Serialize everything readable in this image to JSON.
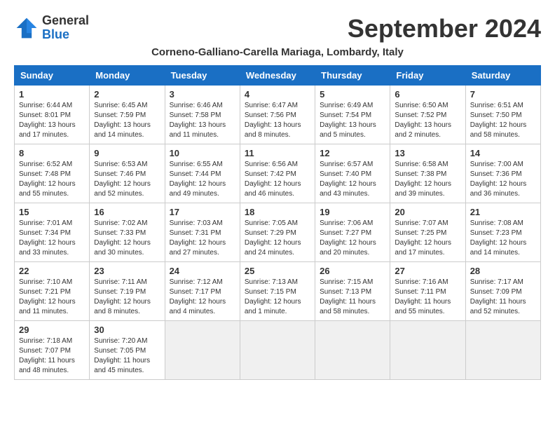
{
  "header": {
    "title": "September 2024",
    "subtitle": "Corneno-Galliano-Carella Mariaga, Lombardy, Italy",
    "logo": {
      "line1": "General",
      "line2": "Blue"
    }
  },
  "weekdays": [
    "Sunday",
    "Monday",
    "Tuesday",
    "Wednesday",
    "Thursday",
    "Friday",
    "Saturday"
  ],
  "weeks": [
    [
      {
        "day": "1",
        "info": "Sunrise: 6:44 AM\nSunset: 8:01 PM\nDaylight: 13 hours and 17 minutes."
      },
      {
        "day": "2",
        "info": "Sunrise: 6:45 AM\nSunset: 7:59 PM\nDaylight: 13 hours and 14 minutes."
      },
      {
        "day": "3",
        "info": "Sunrise: 6:46 AM\nSunset: 7:58 PM\nDaylight: 13 hours and 11 minutes."
      },
      {
        "day": "4",
        "info": "Sunrise: 6:47 AM\nSunset: 7:56 PM\nDaylight: 13 hours and 8 minutes."
      },
      {
        "day": "5",
        "info": "Sunrise: 6:49 AM\nSunset: 7:54 PM\nDaylight: 13 hours and 5 minutes."
      },
      {
        "day": "6",
        "info": "Sunrise: 6:50 AM\nSunset: 7:52 PM\nDaylight: 13 hours and 2 minutes."
      },
      {
        "day": "7",
        "info": "Sunrise: 6:51 AM\nSunset: 7:50 PM\nDaylight: 12 hours and 58 minutes."
      }
    ],
    [
      {
        "day": "8",
        "info": "Sunrise: 6:52 AM\nSunset: 7:48 PM\nDaylight: 12 hours and 55 minutes."
      },
      {
        "day": "9",
        "info": "Sunrise: 6:53 AM\nSunset: 7:46 PM\nDaylight: 12 hours and 52 minutes."
      },
      {
        "day": "10",
        "info": "Sunrise: 6:55 AM\nSunset: 7:44 PM\nDaylight: 12 hours and 49 minutes."
      },
      {
        "day": "11",
        "info": "Sunrise: 6:56 AM\nSunset: 7:42 PM\nDaylight: 12 hours and 46 minutes."
      },
      {
        "day": "12",
        "info": "Sunrise: 6:57 AM\nSunset: 7:40 PM\nDaylight: 12 hours and 43 minutes."
      },
      {
        "day": "13",
        "info": "Sunrise: 6:58 AM\nSunset: 7:38 PM\nDaylight: 12 hours and 39 minutes."
      },
      {
        "day": "14",
        "info": "Sunrise: 7:00 AM\nSunset: 7:36 PM\nDaylight: 12 hours and 36 minutes."
      }
    ],
    [
      {
        "day": "15",
        "info": "Sunrise: 7:01 AM\nSunset: 7:34 PM\nDaylight: 12 hours and 33 minutes."
      },
      {
        "day": "16",
        "info": "Sunrise: 7:02 AM\nSunset: 7:33 PM\nDaylight: 12 hours and 30 minutes."
      },
      {
        "day": "17",
        "info": "Sunrise: 7:03 AM\nSunset: 7:31 PM\nDaylight: 12 hours and 27 minutes."
      },
      {
        "day": "18",
        "info": "Sunrise: 7:05 AM\nSunset: 7:29 PM\nDaylight: 12 hours and 24 minutes."
      },
      {
        "day": "19",
        "info": "Sunrise: 7:06 AM\nSunset: 7:27 PM\nDaylight: 12 hours and 20 minutes."
      },
      {
        "day": "20",
        "info": "Sunrise: 7:07 AM\nSunset: 7:25 PM\nDaylight: 12 hours and 17 minutes."
      },
      {
        "day": "21",
        "info": "Sunrise: 7:08 AM\nSunset: 7:23 PM\nDaylight: 12 hours and 14 minutes."
      }
    ],
    [
      {
        "day": "22",
        "info": "Sunrise: 7:10 AM\nSunset: 7:21 PM\nDaylight: 12 hours and 11 minutes."
      },
      {
        "day": "23",
        "info": "Sunrise: 7:11 AM\nSunset: 7:19 PM\nDaylight: 12 hours and 8 minutes."
      },
      {
        "day": "24",
        "info": "Sunrise: 7:12 AM\nSunset: 7:17 PM\nDaylight: 12 hours and 4 minutes."
      },
      {
        "day": "25",
        "info": "Sunrise: 7:13 AM\nSunset: 7:15 PM\nDaylight: 12 hours and 1 minute."
      },
      {
        "day": "26",
        "info": "Sunrise: 7:15 AM\nSunset: 7:13 PM\nDaylight: 11 hours and 58 minutes."
      },
      {
        "day": "27",
        "info": "Sunrise: 7:16 AM\nSunset: 7:11 PM\nDaylight: 11 hours and 55 minutes."
      },
      {
        "day": "28",
        "info": "Sunrise: 7:17 AM\nSunset: 7:09 PM\nDaylight: 11 hours and 52 minutes."
      }
    ],
    [
      {
        "day": "29",
        "info": "Sunrise: 7:18 AM\nSunset: 7:07 PM\nDaylight: 11 hours and 48 minutes."
      },
      {
        "day": "30",
        "info": "Sunrise: 7:20 AM\nSunset: 7:05 PM\nDaylight: 11 hours and 45 minutes."
      },
      {
        "day": "",
        "info": ""
      },
      {
        "day": "",
        "info": ""
      },
      {
        "day": "",
        "info": ""
      },
      {
        "day": "",
        "info": ""
      },
      {
        "day": "",
        "info": ""
      }
    ]
  ]
}
